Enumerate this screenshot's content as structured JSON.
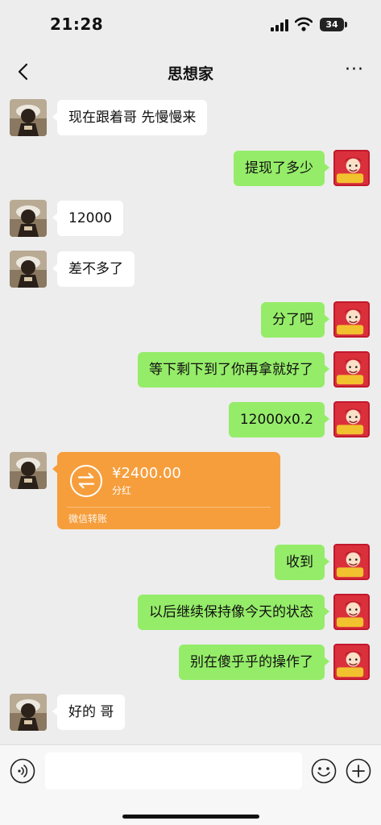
{
  "status_bar": {
    "time": "21:28",
    "battery": "34"
  },
  "header": {
    "title": "思想家",
    "more": "···"
  },
  "messages": [
    {
      "side": "in",
      "text": "现在跟着哥 先慢慢来"
    },
    {
      "side": "out",
      "text": "提现了多少"
    },
    {
      "side": "in",
      "text": "12000"
    },
    {
      "side": "in",
      "text": "差不多了"
    },
    {
      "side": "out",
      "text": "分了吧"
    },
    {
      "side": "out",
      "text": "等下剩下到了你再拿就好了"
    },
    {
      "side": "out",
      "text": "12000x0.2"
    },
    {
      "side": "in",
      "type": "transfer",
      "amount": "¥2400.00",
      "note": "分红",
      "footer": "微信转账"
    },
    {
      "side": "out",
      "text": "收到"
    },
    {
      "side": "out",
      "text": "以后继续保持像今天的状态"
    },
    {
      "side": "out",
      "text": "别在傻乎乎的操作了"
    },
    {
      "side": "in",
      "text": "好的 哥"
    }
  ],
  "input": {
    "placeholder": ""
  },
  "colors": {
    "background": "#ededed",
    "outgoing_bubble": "#95ec69",
    "incoming_bubble": "#ffffff",
    "transfer_card": "#f69e3c"
  },
  "icons": {
    "back": "chevron-left-icon",
    "more": "more-dots-icon",
    "voice": "voice-icon",
    "emoji": "emoji-icon",
    "plus": "plus-icon"
  }
}
